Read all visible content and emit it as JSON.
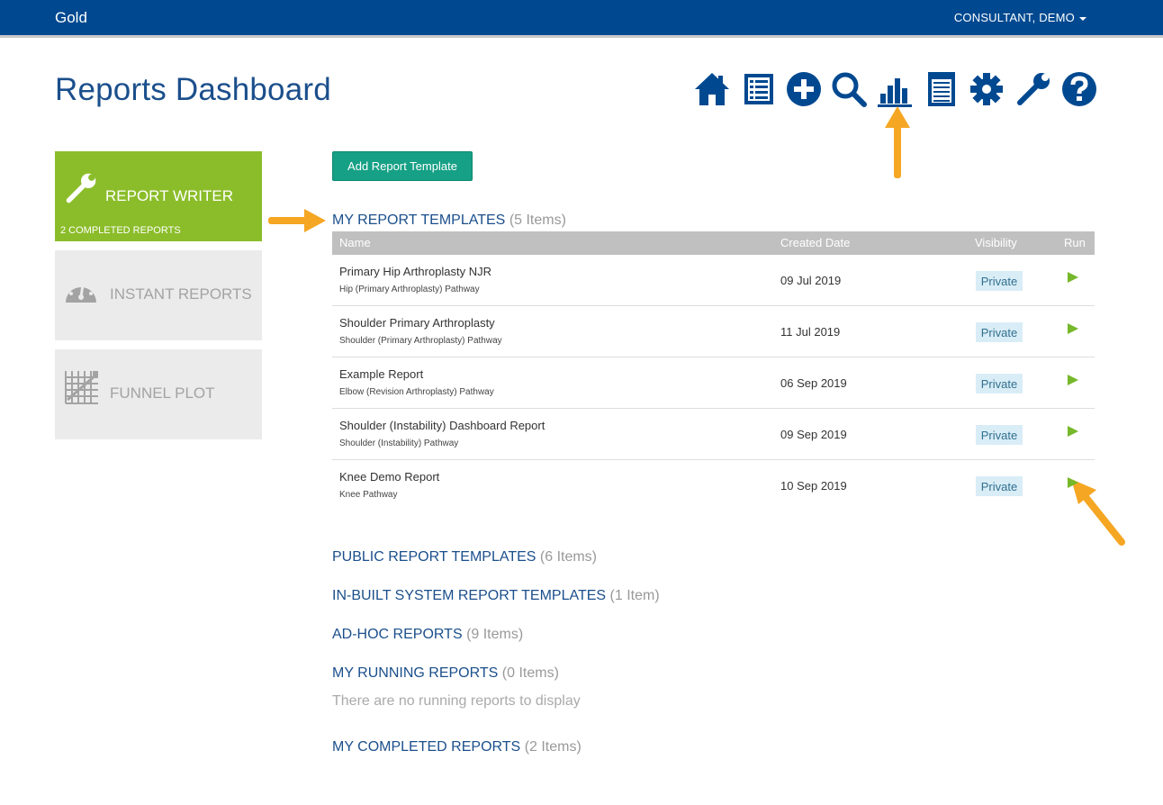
{
  "header": {
    "brand": "Gold",
    "user": "CONSULTANT, DEMO"
  },
  "page_title": "Reports Dashboard",
  "toolbar_icons": [
    "home-icon",
    "list-icon",
    "add-circle-icon",
    "search-icon",
    "bar-chart-icon",
    "notepad-icon",
    "gear-icon",
    "wrench-icon",
    "help-icon"
  ],
  "tiles": {
    "writer": {
      "label": "REPORT WRITER",
      "sub": "2 COMPLETED REPORTS"
    },
    "instant": {
      "label": "INSTANT REPORTS"
    },
    "funnel": {
      "label": "FUNNEL PLOT"
    }
  },
  "add_button": "Add Report Template",
  "my_templates": {
    "title": "MY REPORT TEMPLATES",
    "count": "(5 Items)",
    "columns": {
      "name": "Name",
      "created": "Created Date",
      "visibility": "Visibility",
      "run": "Run"
    },
    "rows": [
      {
        "name": "Primary Hip Arthroplasty NJR",
        "path": "Hip (Primary Arthroplasty) Pathway",
        "date": "09 Jul 2019",
        "visibility": "Private"
      },
      {
        "name": "Shoulder Primary Arthroplasty",
        "path": "Shoulder (Primary Arthroplasty) Pathway",
        "date": "11 Jul 2019",
        "visibility": "Private"
      },
      {
        "name": "Example Report",
        "path": "Elbow (Revision Arthroplasty) Pathway",
        "date": "06 Sep 2019",
        "visibility": "Private"
      },
      {
        "name": "Shoulder (Instability) Dashboard Report",
        "path": "Shoulder (Instability) Pathway",
        "date": "09 Sep 2019",
        "visibility": "Private"
      },
      {
        "name": "Knee Demo Report",
        "path": "Knee Pathway",
        "date": "10 Sep 2019",
        "visibility": "Private"
      }
    ]
  },
  "sections": {
    "public": {
      "title": "PUBLIC REPORT TEMPLATES",
      "count": "(6 Items)"
    },
    "inbuilt": {
      "title": "IN-BUILT SYSTEM REPORT TEMPLATES",
      "count": "(1 Item)"
    },
    "adhoc": {
      "title": "AD-HOC REPORTS",
      "count": "(9 Items)"
    },
    "running": {
      "title": "MY RUNNING REPORTS",
      "count": "(0 Items)",
      "empty": "There are no running reports to display"
    },
    "completed": {
      "title": "MY COMPLETED REPORTS",
      "count": "(2 Items)"
    }
  },
  "colors": {
    "primary": "#004990",
    "heading": "#1b4f8c",
    "writer_tile": "#8bbd2a",
    "add_button": "#16a085",
    "run": "#76b82a",
    "annotation_arrow": "#f5a623"
  }
}
